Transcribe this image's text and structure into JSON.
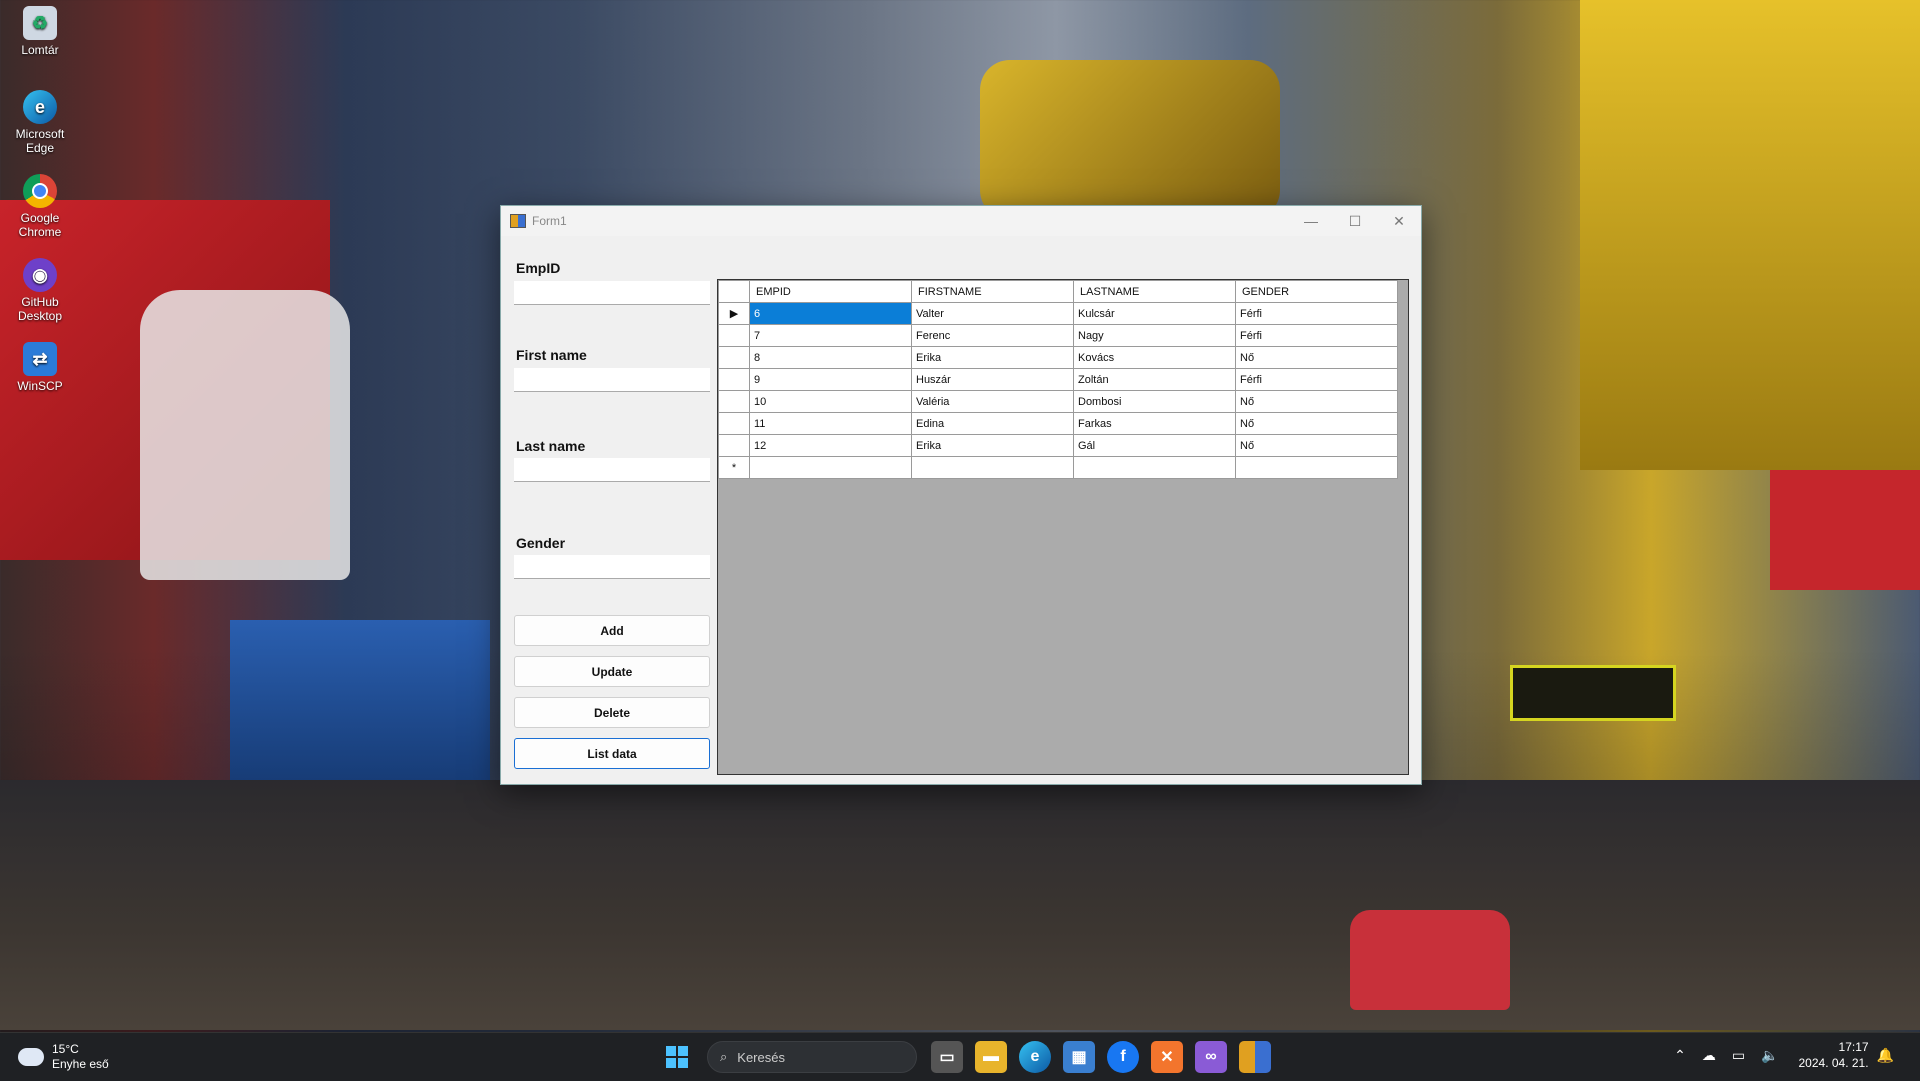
{
  "desktop": {
    "icons": [
      {
        "label": "Lomtár",
        "icon": "recycle-bin-icon"
      },
      {
        "label": "Microsoft Edge",
        "icon": "edge-icon"
      },
      {
        "label": "Google Chrome",
        "icon": "chrome-icon"
      },
      {
        "label": "GitHub Desktop",
        "icon": "github-icon"
      },
      {
        "label": "WinSCP",
        "icon": "winscp-icon"
      }
    ]
  },
  "window": {
    "title": "Form1",
    "controls": {
      "minimize": "—",
      "maximize": "☐",
      "close": "✕"
    }
  },
  "form": {
    "fields": [
      {
        "label": "EmpID",
        "value": ""
      },
      {
        "label": "First name",
        "value": ""
      },
      {
        "label": "Last name",
        "value": ""
      },
      {
        "label": "Gender",
        "value": ""
      }
    ],
    "buttons": {
      "add": "Add",
      "update": "Update",
      "delete": "Delete",
      "list": "List data"
    }
  },
  "grid": {
    "columns": [
      "EMPID",
      "FIRSTNAME",
      "LASTNAME",
      "GENDER"
    ],
    "rows": [
      {
        "empid": "6",
        "first": "Valter",
        "last": "Kulcsár",
        "gender": "Férfi"
      },
      {
        "empid": "7",
        "first": "Ferenc",
        "last": "Nagy",
        "gender": "Férfi"
      },
      {
        "empid": "8",
        "first": "Erika",
        "last": "Kovács",
        "gender": "Nő"
      },
      {
        "empid": "9",
        "first": "Huszár",
        "last": "Zoltán",
        "gender": "Férfi"
      },
      {
        "empid": "10",
        "first": "Valéria",
        "last": "Dombosi",
        "gender": "Nő"
      },
      {
        "empid": "11",
        "first": "Edina",
        "last": "Farkas",
        "gender": "Nő"
      },
      {
        "empid": "12",
        "first": "Erika",
        "last": "Gál",
        "gender": "Nő"
      }
    ],
    "current_row_marker": "▶",
    "new_row_marker": "*"
  },
  "taskbar": {
    "weather": {
      "temp": "15°C",
      "desc": "Enyhe eső"
    },
    "search_placeholder": "Keresés",
    "clock": {
      "time": "17:17",
      "date": "2024. 04. 21."
    }
  }
}
